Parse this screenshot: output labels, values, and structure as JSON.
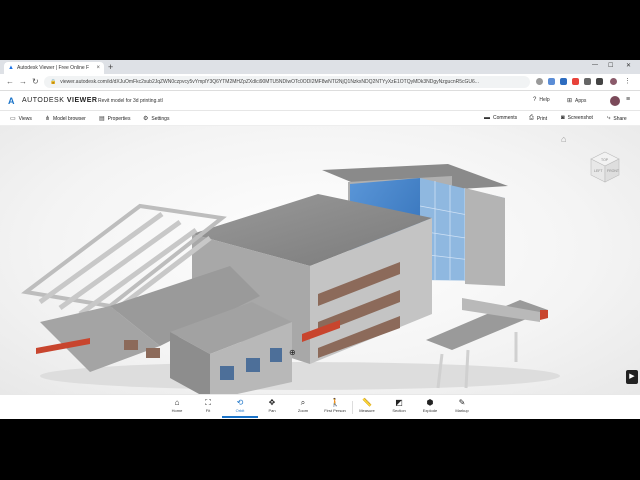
{
  "browser": {
    "tab_title": "Autodesk Viewer | Free Online F",
    "tab_close": "×",
    "new_tab": "+",
    "url": "viewer.autodesk.com/id/dXJuOmFkc2sub2JqZWN0czpvcy5vYmplY3Q6YTM2MHZpZXdlci90MTU5NDIwOTc0ODI2MF8wNTI2NjQ1NzkxNDQ2NTYyXzE1OTQyMDk3NDgyNzgucnR5cGU6...",
    "nav": {
      "back": "←",
      "forward": "→",
      "reload": "↻"
    },
    "win": {
      "min": "—",
      "max": "☐",
      "close": "✕"
    }
  },
  "app": {
    "logo": "A",
    "brand": "AUTODESK",
    "product": "VIEWER",
    "subtitle": "Revit model for 3d printing.stl",
    "help_label": "Help",
    "apps_label": "Apps",
    "menu_icon": "≡"
  },
  "toolbar_top": {
    "views": "Views",
    "model_browser": "Model browser",
    "properties": "Properties",
    "settings": "Settings",
    "comments": "Comments",
    "print": "Print",
    "screenshot": "Screenshot",
    "share": "Share"
  },
  "viewcube": {
    "front": "FRONT",
    "left": "LEFT",
    "top": "TOP"
  },
  "toolbar_bottom": {
    "home": "Home",
    "fit": "Fit",
    "orbit": "Orbit",
    "pan": "Pan",
    "zoom": "Zoom",
    "first_person": "First Person",
    "measure": "Measure",
    "section": "Section",
    "explode": "Explode",
    "markup": "Markup"
  },
  "colors": {
    "accent": "#1a73c8",
    "glass": "#3f7fc4",
    "accent_red": "#c8452e"
  }
}
